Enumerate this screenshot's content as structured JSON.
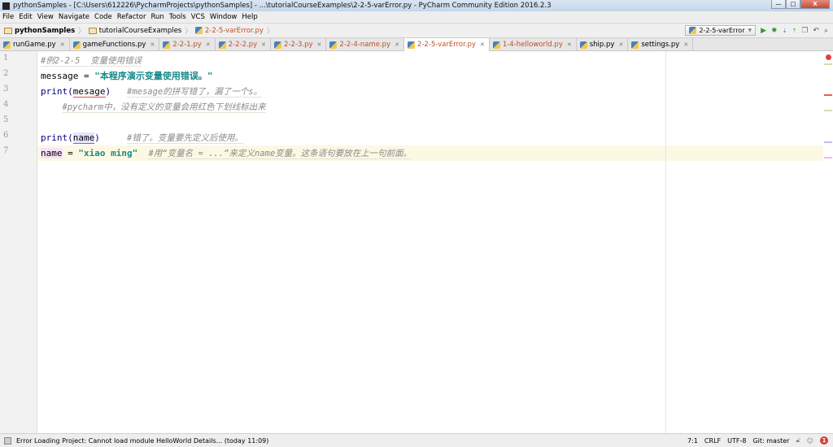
{
  "window": {
    "title": "pythonSamples - [C:\\Users\\612226\\PycharmProjects\\pythonSamples] - ...\\tutorialCourseExamples\\2-2-5-varError.py - PyCharm Community Edition 2016.2.3"
  },
  "menu": [
    "File",
    "Edit",
    "View",
    "Navigate",
    "Code",
    "Refactor",
    "Run",
    "Tools",
    "VCS",
    "Window",
    "Help"
  ],
  "breadcrumb": [
    "pythonSamples",
    "tutorialCourseExamples",
    "2-2-5-varError.py"
  ],
  "run_config": "2-2-5-varError",
  "tabs": [
    {
      "label": "runGame.py",
      "modified": false
    },
    {
      "label": "gameFunctions.py",
      "modified": false
    },
    {
      "label": "2-2-1.py",
      "modified": true
    },
    {
      "label": "2-2-2.py",
      "modified": true
    },
    {
      "label": "2-2-3.py",
      "modified": true
    },
    {
      "label": "2-2-4-name.py",
      "modified": true
    },
    {
      "label": "2-2-5-varError.py",
      "modified": true,
      "active": true
    },
    {
      "label": "1-4-helloworld.py",
      "modified": true
    },
    {
      "label": "ship.py",
      "modified": false
    },
    {
      "label": "settings.py",
      "modified": false
    }
  ],
  "editor": {
    "line_numbers": [
      "1",
      "2",
      "3",
      "4",
      "5",
      "6",
      "7"
    ],
    "lines": {
      "l1_comment": "#例2-2-5  变量使用错误",
      "l2_var": "message = ",
      "l2_str": "\"本程序演示变量使用错误。\"",
      "l3_print": "print(",
      "l3_arg": "mesage",
      "l3_close": ")",
      "l3_comment": "#mesage的拼写错了，漏了一个s。",
      "l4_comment": "#pycharm中，没有定义的变量会用红色下划线标出来",
      "l6_print": "print(",
      "l6_arg": "name",
      "l6_close": ")",
      "l6_comment": "#错了。变量要先定义后使用。",
      "l7_var": "name",
      "l7_eq": " = ",
      "l7_str": "\"xiao ming\"",
      "l7_comment": "#用“变量名 = ...”来定义name变量。这条语句要放在上一句前面。"
    },
    "error_count": "1"
  },
  "status": {
    "message": "Error Loading Project: Cannot load module HelloWorld Details... (today 11:09)",
    "position": "7:1",
    "line_sep": "CRLF",
    "encoding": "UTF-8",
    "git": "Git: master"
  }
}
